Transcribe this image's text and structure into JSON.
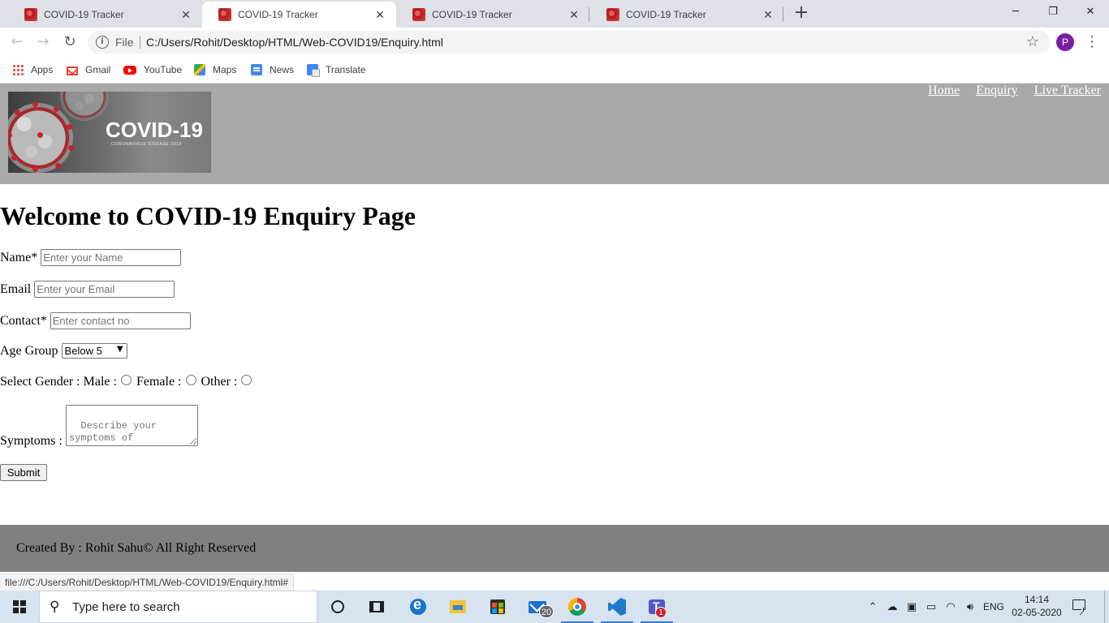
{
  "browser": {
    "tabs": [
      {
        "title": "COVID-19 Tracker",
        "active": false
      },
      {
        "title": "COVID-19 Tracker",
        "active": true
      },
      {
        "title": "COVID-19 Tracker",
        "active": false
      },
      {
        "title": "COVID-19 Tracker",
        "active": false
      }
    ],
    "address": {
      "scheme": "File",
      "url": "C:/Users/Rohit/Desktop/HTML/Web-COVID19/Enquiry.html"
    },
    "profile_initial": "P",
    "bookmarks": [
      "Apps",
      "Gmail",
      "YouTube",
      "Maps",
      "News",
      "Translate"
    ],
    "status_url": "file:///C:/Users/Rohit/Desktop/HTML/Web-COVID19/Enquiry.html#"
  },
  "site": {
    "logo": {
      "text": "COVID-19",
      "subtext": "CORONAVIRUS DISEASE 2019"
    },
    "nav": [
      "Home",
      "Enquiry",
      "Live Tracker"
    ],
    "heading": "Welcome to COVID-19 Enquiry Page",
    "form": {
      "name_label": "Name*",
      "name_placeholder": "Enter your Name",
      "email_label": "Email",
      "email_placeholder": "Enter your Email",
      "contact_label": "Contact*",
      "contact_placeholder": "Enter contact no",
      "age_label": "Age Group",
      "age_selected": "Below 5",
      "gender_label": "Select Gender :",
      "gender_options": [
        "Male :",
        "Female :",
        "Other :"
      ],
      "symptoms_label": "Symptoms :",
      "symptoms_placeholder": "Describe your symptoms of coronavirus",
      "submit_label": "Submit"
    },
    "footer": "Created By : Rohit Sahu© All Right Reserved"
  },
  "taskbar": {
    "search_placeholder": "Type here to search",
    "mail_badge": "20",
    "teams_badge": "1",
    "language": "ENG",
    "time": "14:14",
    "date": "02-05-2020"
  }
}
